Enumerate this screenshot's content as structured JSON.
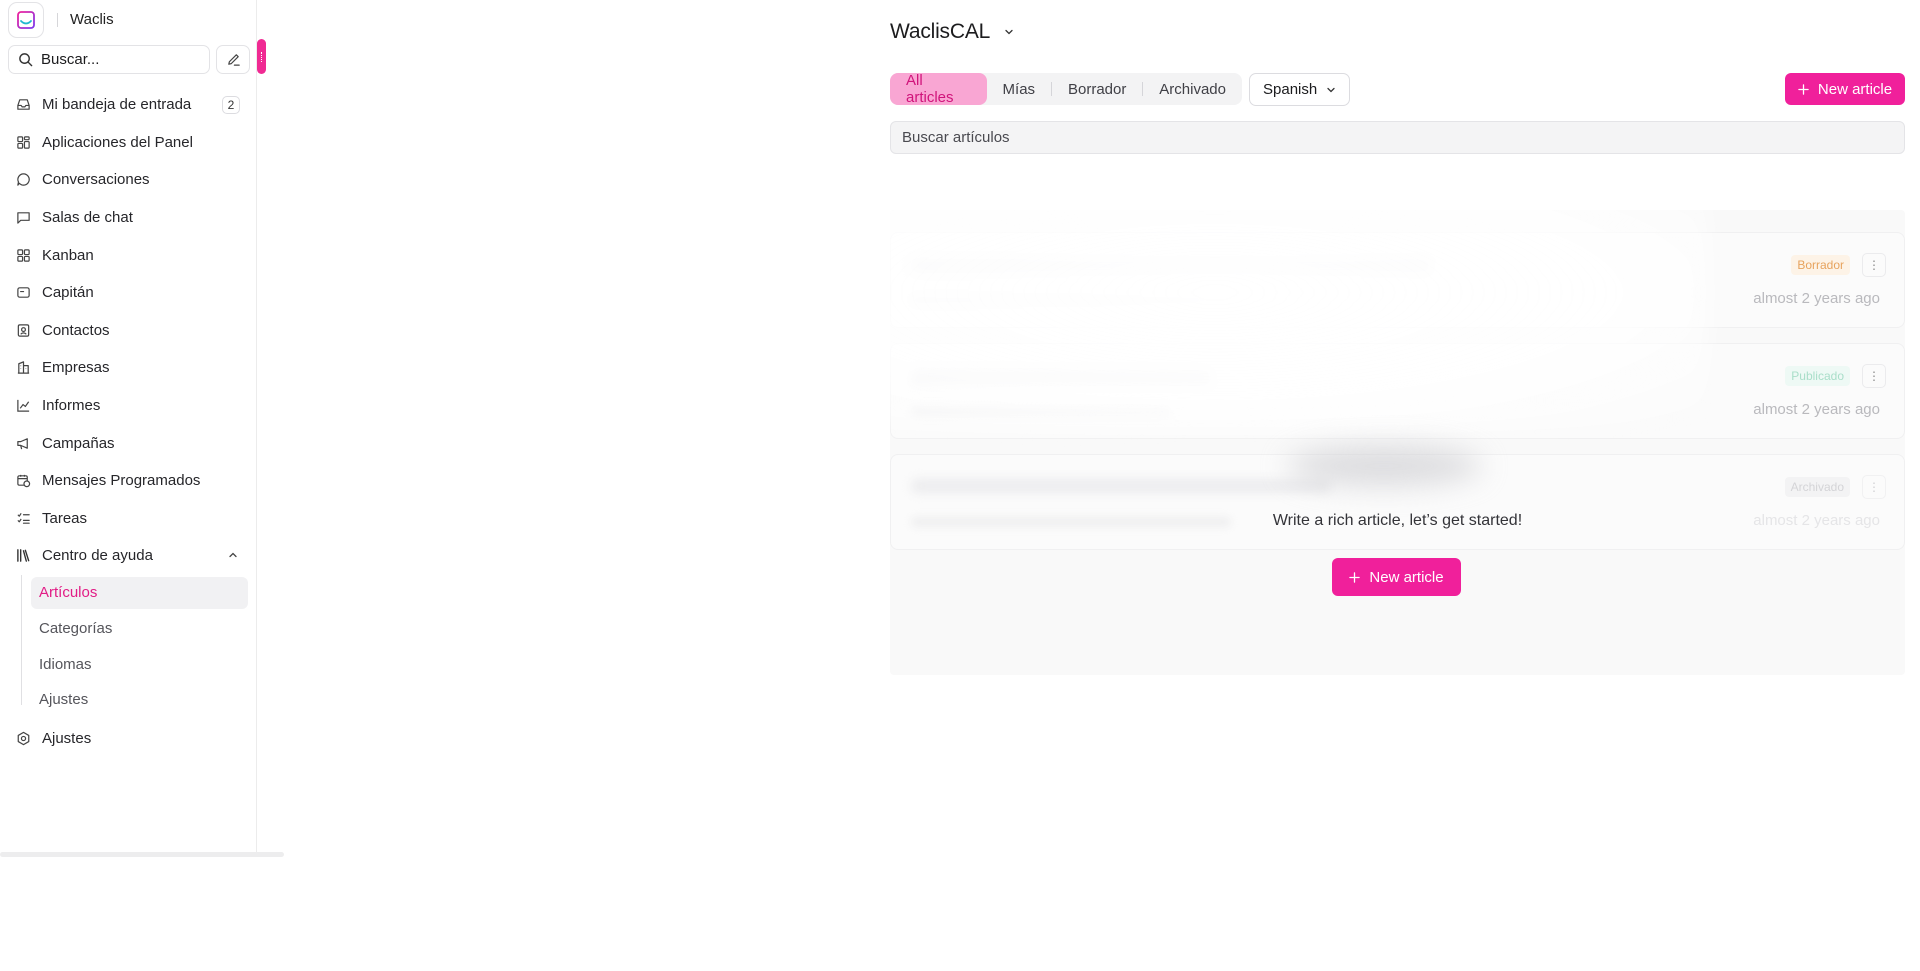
{
  "app": {
    "name": "Waclis",
    "accent": "#f0209b"
  },
  "sidebar": {
    "search_placeholder": "Buscar...",
    "items": [
      {
        "label": "Mi bandeja de entrada",
        "icon": "inbox-icon",
        "badge": "2"
      },
      {
        "label": "Aplicaciones del Panel",
        "icon": "apps-icon"
      },
      {
        "label": "Conversaciones",
        "icon": "chat-bubble-icon"
      },
      {
        "label": "Salas de chat",
        "icon": "message-square-icon"
      },
      {
        "label": "Kanban",
        "icon": "kanban-icon"
      },
      {
        "label": "Capitán",
        "icon": "bot-icon"
      },
      {
        "label": "Contactos",
        "icon": "contacts-icon"
      },
      {
        "label": "Empresas",
        "icon": "building-icon"
      },
      {
        "label": "Informes",
        "icon": "chart-line-icon"
      },
      {
        "label": "Campañas",
        "icon": "megaphone-icon"
      },
      {
        "label": "Mensajes Programados",
        "icon": "calendar-clock-icon"
      },
      {
        "label": "Tareas",
        "icon": "tasks-icon"
      },
      {
        "label": "Centro de ayuda",
        "icon": "library-icon",
        "expanded": true
      }
    ],
    "help_center_children": [
      {
        "label": "Artículos",
        "active": true
      },
      {
        "label": "Categorías"
      },
      {
        "label": "Idiomas"
      },
      {
        "label": "Ajustes"
      }
    ],
    "settings": {
      "label": "Ajustes",
      "icon": "settings-icon"
    }
  },
  "main": {
    "portal_name": "WaclisCAL",
    "tabs": [
      {
        "label": "All articles",
        "active": true
      },
      {
        "label": "Mías"
      },
      {
        "label": "Borrador"
      },
      {
        "label": "Archivado"
      }
    ],
    "language": "Spanish",
    "new_article_label": "New article",
    "search_placeholder": "Buscar artículos",
    "ghost_rows": [
      {
        "status": "Borrador",
        "time": "almost 2 years ago"
      },
      {
        "status": "Publicado",
        "time": "almost 2 years ago"
      },
      {
        "status": "Archivado",
        "time": "almost 2 years ago"
      }
    ],
    "empty_state": {
      "message": "Write a rich article, let’s get started!",
      "button_label": "New article"
    }
  }
}
